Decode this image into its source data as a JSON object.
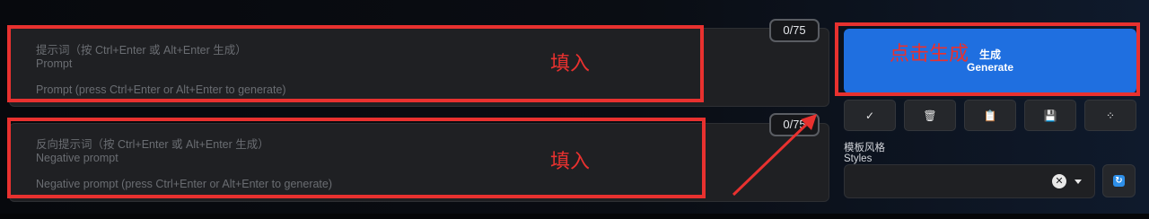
{
  "prompt": {
    "counter": "0/75",
    "placeholder_title_zh": "提示词（按 Ctrl+Enter 或 Alt+Enter 生成）",
    "placeholder_title_en": "Prompt",
    "placeholder_hint": "Prompt (press Ctrl+Enter or Alt+Enter to generate)"
  },
  "negative_prompt": {
    "counter": "0/75",
    "placeholder_title_zh": "反向提示词（按 Ctrl+Enter 或 Alt+Enter 生成）",
    "placeholder_title_en": "Negative prompt",
    "placeholder_hint": "Negative prompt (press Ctrl+Enter or Alt+Enter to generate)"
  },
  "generate": {
    "label_zh": "生成",
    "label_en": "Generate",
    "color": "#1f6fe0"
  },
  "toolbar": [
    {
      "icon": "check-icon",
      "glyph": "✓"
    },
    {
      "icon": "trash-icon",
      "glyph": "🗑"
    },
    {
      "icon": "clipboard-icon",
      "glyph": "📋"
    },
    {
      "icon": "save-icon",
      "glyph": "💾"
    },
    {
      "icon": "magic-wand-icon",
      "glyph": "⁘"
    }
  ],
  "styles": {
    "label_zh": "模板风格",
    "label_en": "Styles",
    "value": "",
    "clear_glyph": "✕",
    "refresh_glyph": "↻"
  },
  "annotations": {
    "fill_text": "填入",
    "click_text": "点击生成",
    "color": "#e8312f"
  }
}
